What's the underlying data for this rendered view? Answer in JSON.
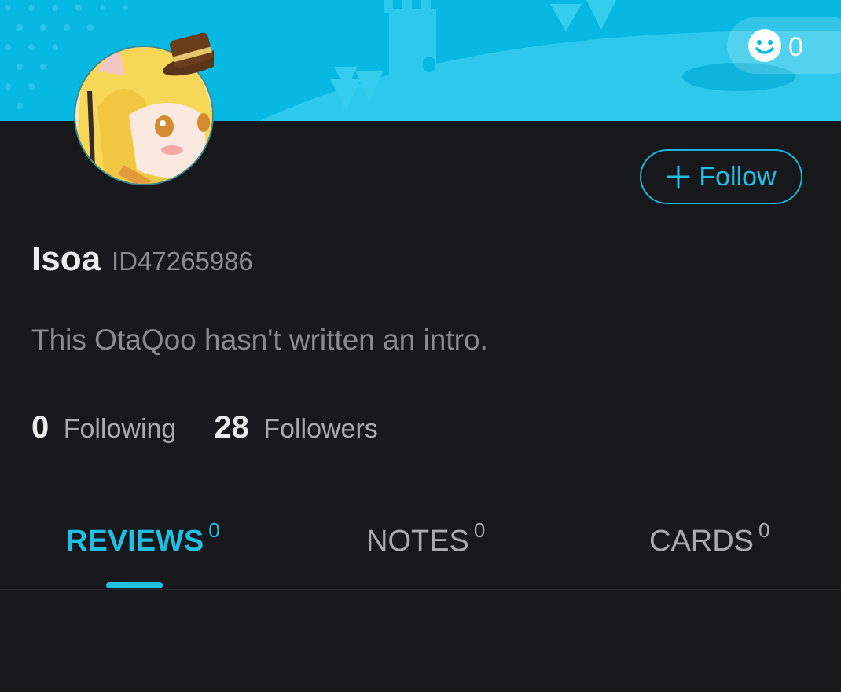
{
  "header": {
    "smile_count": "0",
    "accent_color": "#07b9e2"
  },
  "profile": {
    "username": "Isoa",
    "user_id": "ID47265986",
    "intro": "This OtaQoo hasn't written an intro.",
    "follow_label": "Follow",
    "following_count": "0",
    "following_label": "Following",
    "followers_count": "28",
    "followers_label": "Followers"
  },
  "tabs": [
    {
      "label": "REVIEWS",
      "count": "0",
      "active": true
    },
    {
      "label": "NOTES",
      "count": "0",
      "active": false
    },
    {
      "label": "CARDS",
      "count": "0",
      "active": false
    }
  ],
  "colors": {
    "background": "#17181c",
    "active_tab": "#1fc0e3",
    "muted_text": "#8a8b90"
  }
}
